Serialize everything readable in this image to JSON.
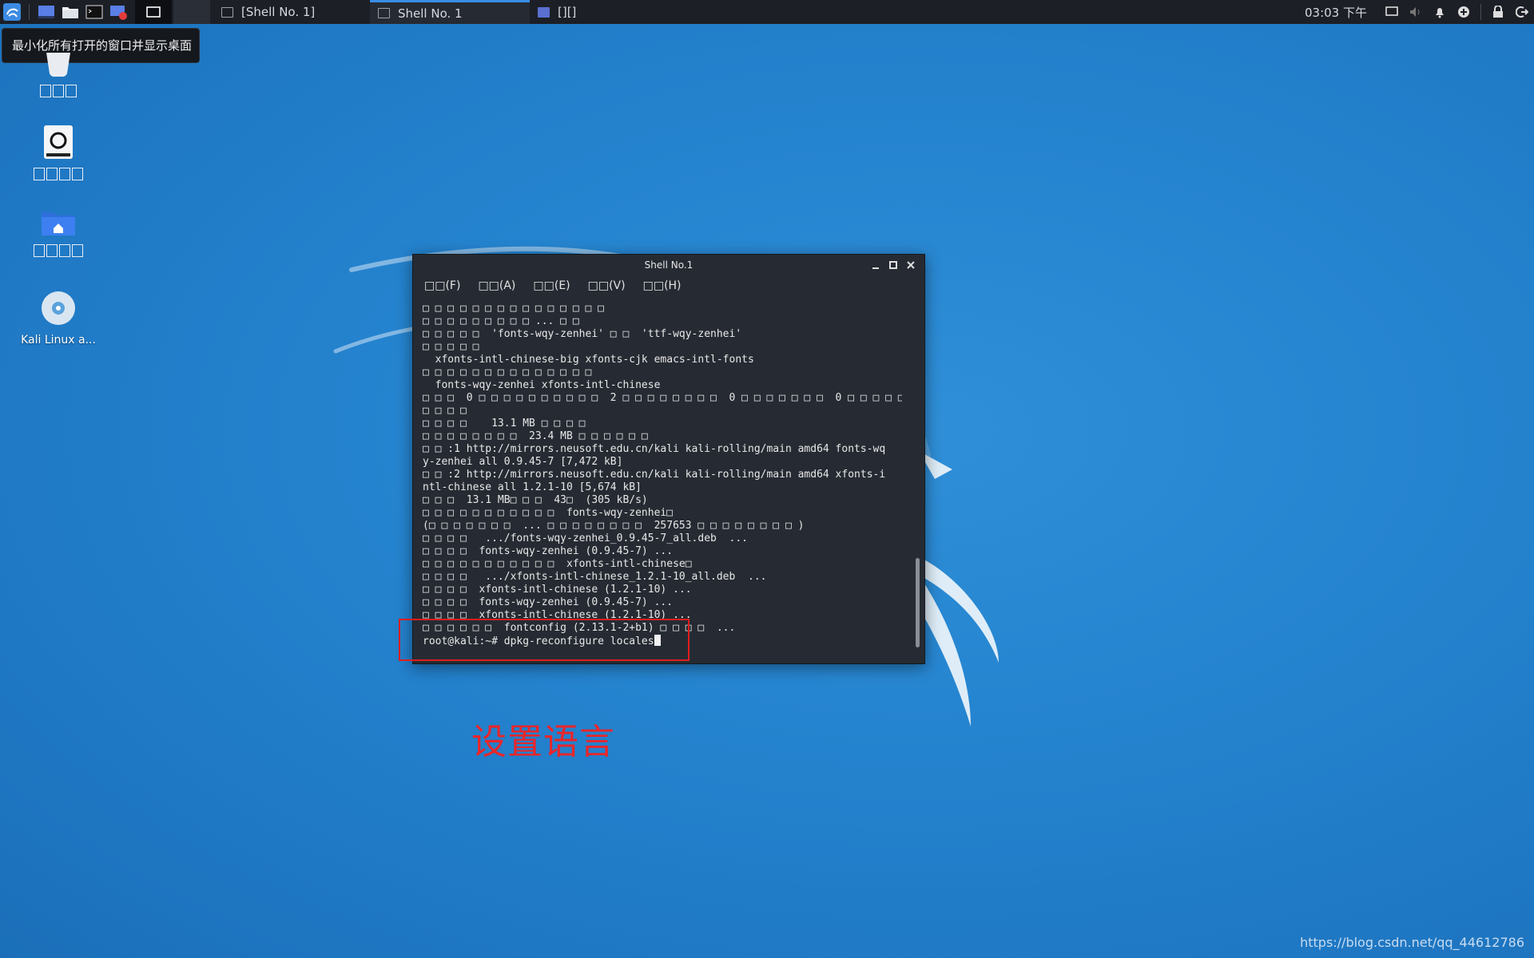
{
  "taskbar": {
    "tasks": [
      {
        "label": "[Shell No. 1]"
      },
      {
        "label": "Shell No. 1"
      },
      {
        "label": "[][]"
      }
    ],
    "clock": "03:03 下午"
  },
  "tooltip": "最小化所有打开的窗口并显示桌面",
  "desktop": {
    "icons": [
      {
        "name": "trash",
        "label": ""
      },
      {
        "name": "file-system",
        "label": ""
      },
      {
        "name": "home",
        "label": ""
      },
      {
        "name": "kali-live",
        "label": "Kali Linux a..."
      }
    ]
  },
  "terminal": {
    "title": "Shell No.1",
    "menu": [
      "□□(F)",
      "□□(A)",
      "□□(E)",
      "□□(V)",
      "□□(H)"
    ],
    "lines": [
      "□ □ □ □ □ □ □ □ □ □ □ □ □ □ □",
      "□ □ □ □ □ □ □ □ □ ... □ □",
      "□ □ □ □ □  'fonts-wqy-zenhei' □ □  'ttf-wqy-zenhei'",
      "□ □ □ □ □",
      "  xfonts-intl-chinese-big xfonts-cjk emacs-intl-fonts",
      "□ □ □ □ □ □ □ □ □ □ □ □ □ □",
      "  fonts-wqy-zenhei xfonts-intl-chinese",
      "□ □ □  0 □ □ □ □ □ □ □ □ □ □  2 □ □ □ □ □ □ □ □  0 □ □ □ □ □ □ □  0 □ □ □ □ □",
      "□ □ □ □",
      "□ □ □ □    13.1 MB □ □ □ □",
      "□ □ □ □ □ □ □ □  23.4 MB □ □ □ □ □ □",
      "□ □ :1 http://mirrors.neusoft.edu.cn/kali kali-rolling/main amd64 fonts-wq",
      "y-zenhei all 0.9.45-7 [7,472 kB]",
      "□ □ :2 http://mirrors.neusoft.edu.cn/kali kali-rolling/main amd64 xfonts-i",
      "ntl-chinese all 1.2.1-10 [5,674 kB]",
      "□ □ □  13.1 MB□ □ □  43□  (305 kB/s)",
      "□ □ □ □ □ □ □ □ □ □ □  fonts-wqy-zenhei□",
      "(□ □ □ □ □ □ □  ... □ □ □ □ □ □ □ □  257653 □ □ □ □ □ □ □ □ )",
      "□ □ □ □   .../fonts-wqy-zenhei_0.9.45-7_all.deb  ...",
      "□ □ □ □  fonts-wqy-zenhei (0.9.45-7) ...",
      "□ □ □ □ □ □ □ □ □ □ □  xfonts-intl-chinese□",
      "□ □ □ □   .../xfonts-intl-chinese_1.2.1-10_all.deb  ...",
      "□ □ □ □  xfonts-intl-chinese (1.2.1-10) ...",
      "□ □ □ □  fonts-wqy-zenhei (0.9.45-7) ...",
      "□ □ □ □  xfonts-intl-chinese (1.2.1-10) ...",
      "□ □ □ □ □ □  fontconfig (2.13.1-2+b1) □ □ □ □  ..."
    ],
    "prompt": "root@kali:~# dpkg-reconfigure locales"
  },
  "annotation": "设置语言",
  "watermark": "https://blog.csdn.net/qq_44612786",
  "colors": {
    "annotation": "#e8262a",
    "desktop": "#2584cf",
    "terminal_bg": "#262b33"
  }
}
